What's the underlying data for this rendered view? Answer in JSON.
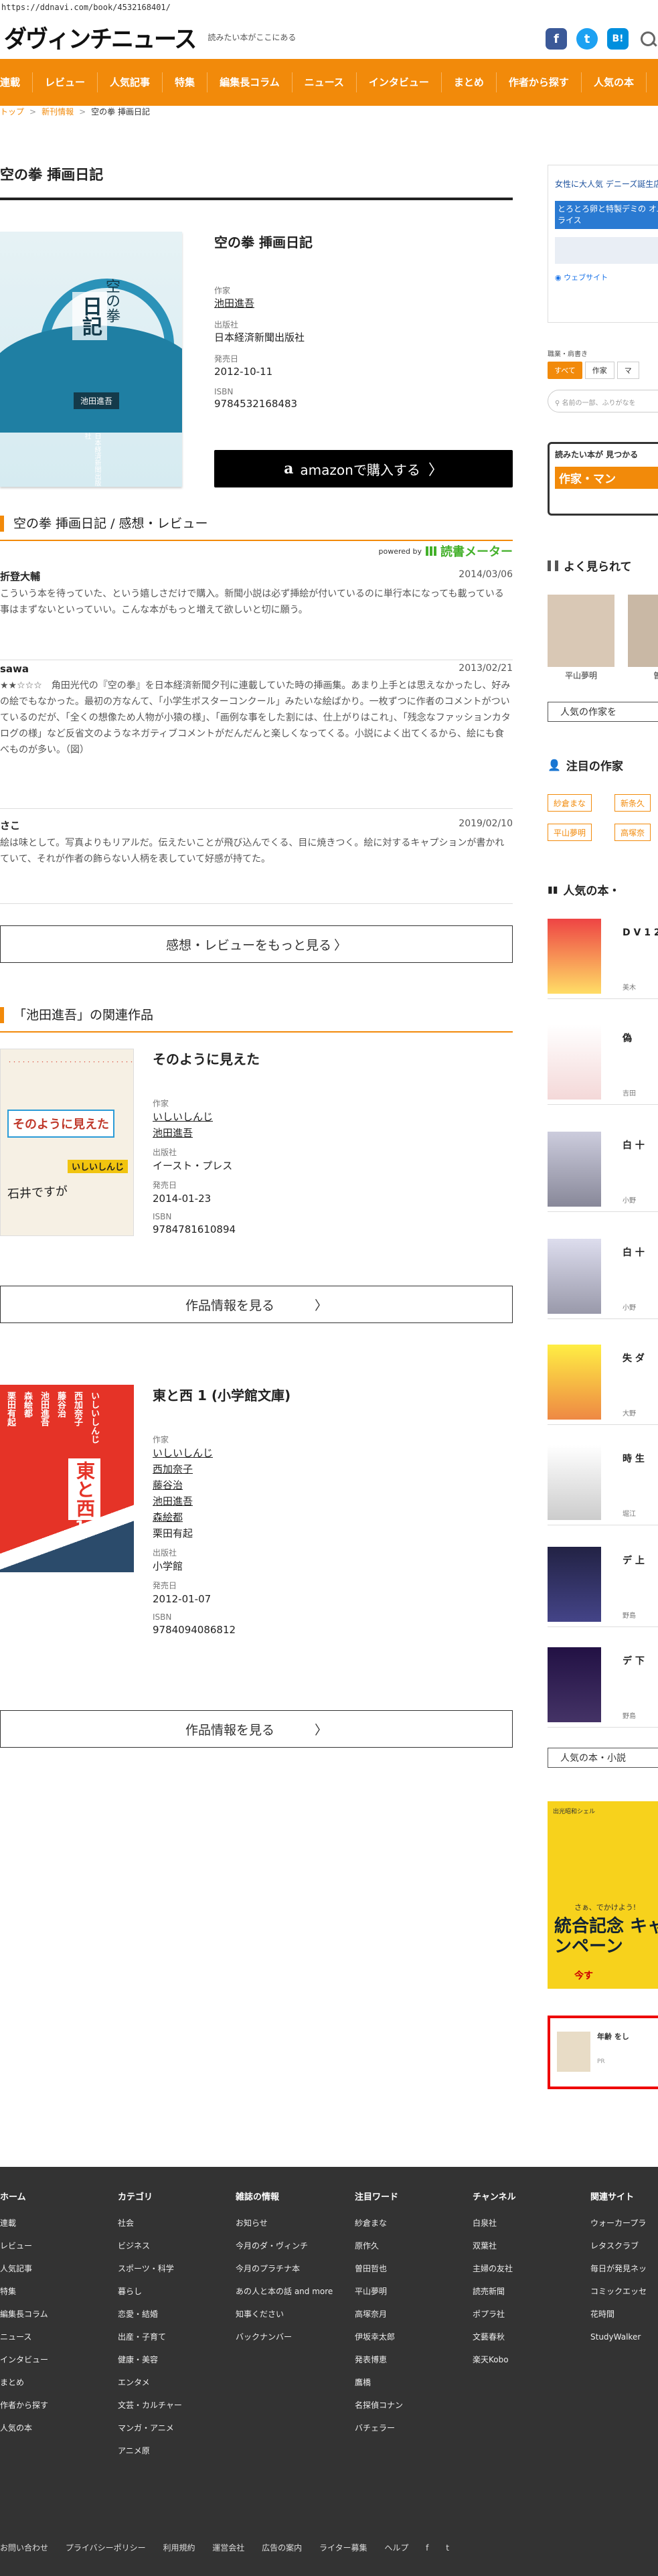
{
  "url": "https://ddnavi.com/book/4532168401/",
  "header": {
    "logo": "ダヴィンチニュース",
    "tagline": "読みたい本がここにある",
    "icons": [
      "facebook-icon",
      "twitter-icon",
      "hatena-icon",
      "search-icon"
    ],
    "fb": "f",
    "tw": "t",
    "hb": "B!"
  },
  "nav": [
    "連載",
    "レビュー",
    "人気記事",
    "特集",
    "編集長コラム",
    "ニュース",
    "インタビュー",
    "まとめ",
    "作者から探す",
    "人気の本"
  ],
  "breadcrumb": [
    "トップ",
    "新刊情報",
    "空の拳 挿画日記"
  ],
  "book": {
    "title": "空の拳 挿画日記",
    "author_label": "作家",
    "author": "池田進吾",
    "publisher_label": "出版社",
    "publisher": "日本経済新聞出版社",
    "date_label": "発売日",
    "date": "2012-10-11",
    "isbn_label": "ISBN",
    "isbn": "9784532168483",
    "amazon_label": "amazonで購入する",
    "cover_title": "日記",
    "cover_title2": "空の拳",
    "cover_author": "池田進吾",
    "cover_pub": "日本経済新聞出版社"
  },
  "reviews_heading": "空の拳 挿画日記 / 感想・レビュー",
  "powered_by": "powered by",
  "powered_brand": "読書メーター",
  "reviews": [
    {
      "name": "折登大輔",
      "date": "2014/03/06",
      "text": "こういう本を待っていた、という嬉しさだけで購入。新聞小説は必ず挿絵が付いているのに単行本になっても載っている事はまずないといっていい。こんな本がもっと増えて欲しいと切に願う。"
    },
    {
      "name": "sawa",
      "date": "2013/02/21",
      "text": "★★☆☆☆　角田光代の『空の拳』を日本経済新聞夕刊に連載していた時の挿画集。あまり上手とは思えなかったし、好みの絵でもなかった。最初の方なんて、「小学生ポスターコンクール」みたいな絵ばかり。一枚ずつに作者のコメントがついているのだが、「全くの想像ため人物が小猿の様」、「画例な事をした割には、仕上がりはこれ」、「残念なファッションカタログの様」など反省文のようなネガティブコメントがだんだんと楽しくなってくる。小説によく出てくるから、絵にも食べものが多い。（図）"
    },
    {
      "name": "さこ",
      "date": "2019/02/10",
      "text": "絵は味として。写真よりもリアルだ。伝えたいことが飛び込んでくる、目に焼きつく。絵に対するキャプションが書かれていて、それが作者の飾らない人柄を表していて好感が持てた。"
    }
  ],
  "more_reviews_label": "感想・レビューをもっと見る",
  "related_heading": "「池田進吾」の関連作品",
  "related": [
    {
      "title": "そのように見えた",
      "author_label": "作家",
      "authors": [
        "いしいしんじ",
        "池田進吾"
      ],
      "publisher_label": "出版社",
      "publisher": "イースト・プレス",
      "date_label": "発売日",
      "date": "2014-01-23",
      "isbn_label": "ISBN",
      "isbn": "9784781610894",
      "button": "作品情報を見る",
      "cover_title": "そのように見えた",
      "cover_author": "いしいしんじ",
      "cover_hand": "石井ですが"
    },
    {
      "title": "東と西 1 (小学館文庫)",
      "author_label": "作家",
      "authors": [
        "いしいしんじ",
        "西加奈子",
        "藤谷治",
        "池田進吾",
        "森絵都",
        "栗田有起"
      ],
      "publisher_label": "出版社",
      "publisher": "小学館",
      "date_label": "発売日",
      "date": "2012-01-07",
      "isbn_label": "ISBN",
      "isbn": "9784094086812",
      "button": "作品情報を見る",
      "cover_title": "東と西",
      "cover_num": "1",
      "cover_names": [
        "いしいしんじ",
        "西加奈子",
        "藤谷治",
        "池田進吾",
        "森絵都",
        "栗田有起"
      ]
    }
  ],
  "sidebar": {
    "ad_text": "女性に大人気 デニーズ誕生店",
    "ad_text2": "とろとろ卵と特製デミの オムライス",
    "ad_link": "ウェブサイト",
    "filter_label": "職業・肩書き",
    "filters": [
      "すべて",
      "作家",
      "マ"
    ],
    "search_placeholder": "名前の一部、ふりがなを",
    "banner": "読みたい本が 見つかる",
    "banner2": "作家・マン",
    "popular_heading": "よく見られて",
    "popular_names": [
      "平山夢明",
      "曽田"
    ],
    "popular_btn": "人気の作家を",
    "notable_heading": "注目の作家",
    "notable_tags": [
      "紗倉まな",
      "新条久",
      "平山夢明",
      "高塚奈"
    ],
    "popular_books_heading": "人気の本・",
    "books": [
      {
        "t": "D V 1 2 グ",
        "a": "美木"
      },
      {
        "t": "偽",
        "a": "吉田"
      },
      {
        "t": "白 十",
        "a": "小野"
      },
      {
        "t": "白 十",
        "a": "小野"
      },
      {
        "t": "失 ダ",
        "a": "大野"
      },
      {
        "t": "時 生",
        "a": "堀江"
      },
      {
        "t": "デ 上",
        "a": "野島"
      },
      {
        "t": "デ 下",
        "a": "野島"
      }
    ],
    "popular_books_btn": "人気の本・小説",
    "ad2_title": "統合記念 キャンペーン",
    "ad2_sub": "さぁ、でかけよう!",
    "ad2_top": "出光昭和シェル",
    "ad2_bottom": "今す",
    "ad3_text": "年齢 をし",
    "ad3_sub": "PR"
  },
  "footer": {
    "columns": [
      {
        "h": "ホーム",
        "items": [
          "連載",
          "レビュー",
          "人気記事",
          "特集",
          "編集長コラム",
          "ニュース",
          "インタビュー",
          "まとめ",
          "作者から探す",
          "人気の本"
        ]
      },
      {
        "h": "カテゴリ",
        "items": [
          "社会",
          "ビジネス",
          "スポーツ・科学",
          "暮らし",
          "恋愛・結婚",
          "出産・子育て",
          "健康・美容",
          "エンタメ",
          "文芸・カルチャー",
          "マンガ・アニメ",
          "アニメ原"
        ]
      },
      {
        "h": "雑誌の情報",
        "items": [
          "お知らせ",
          "今月のダ・ヴィンチ",
          "今月のプラチナ本",
          "あの人と本の話 and more",
          "知事ください",
          "バックナンバー"
        ]
      },
      {
        "h": "注目ワード",
        "items": [
          "紗倉まな",
          "原作久",
          "曽田哲也",
          "平山夢明",
          "高塚奈月",
          "伊坂幸太郎",
          "発表博恵",
          "鷹橋",
          "名探偵コナン",
          "バチェラー"
        ]
      },
      {
        "h": "チャンネル",
        "items": [
          "白泉社",
          "双葉社",
          "主婦の友社",
          "読売新聞",
          "ポプラ社",
          "文藝春秋",
          "楽天Kobo"
        ]
      },
      {
        "h": "関連サイト",
        "items": [
          "ウォーカープラ",
          "レタスクラブ",
          "毎日が発見ネッ",
          "コミックエッセ",
          "花時間",
          "StudyWalker"
        ]
      }
    ],
    "bottom": [
      "お問い合わせ",
      "プライバシーポリシー",
      "利用規約",
      "運営会社",
      "広告の案内",
      "ライター募集",
      "ヘルプ"
    ]
  }
}
